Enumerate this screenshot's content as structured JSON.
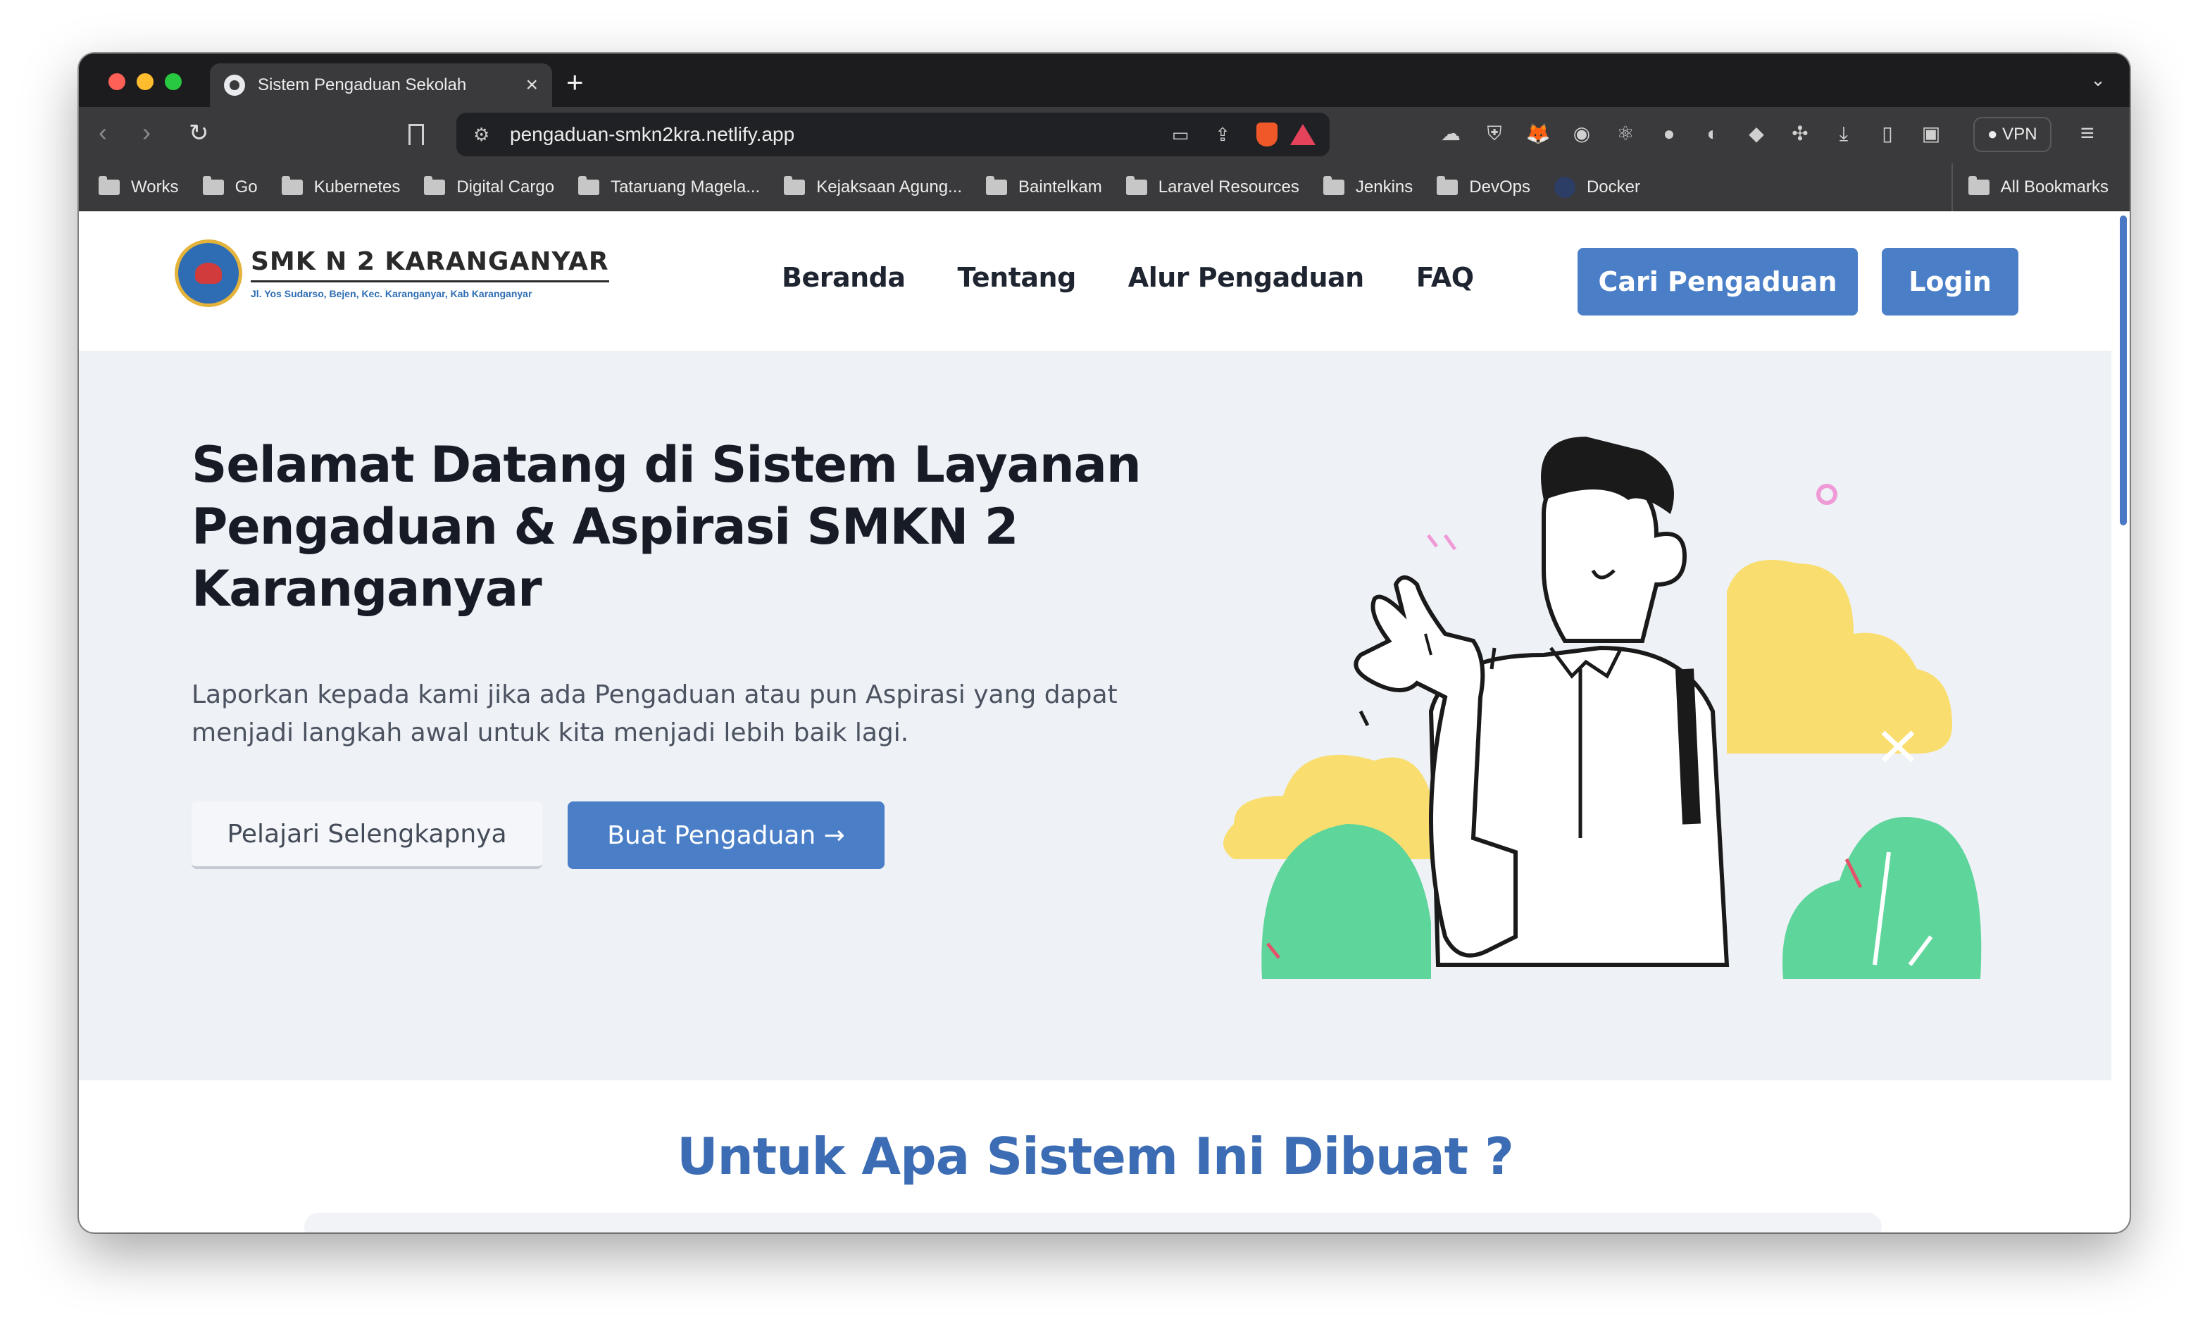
{
  "browser": {
    "tab_title": "Sistem Pengaduan Sekolah",
    "tab_close": "×",
    "new_tab": "+",
    "tab_menu": "⌄",
    "nav_back": "‹",
    "nav_forward": "›",
    "nav_reload": "↻",
    "site_info_icon": "⚙",
    "url": "pengaduan-smkn2kra.netlify.app",
    "cast_icon": "▭",
    "share_icon": "⇪",
    "vpn_label": "VPN",
    "menu_icon": "≡",
    "extension_icons": [
      "cloud-icon",
      "shield-icon",
      "fox-icon",
      "camera-icon",
      "react-icon",
      "brain-icon",
      "cat-icon",
      "puzzle-badge-icon",
      "puzzle-icon",
      "download-icon",
      "sidebar-icon",
      "wallet-icon"
    ],
    "extension_glyphs": [
      "☁",
      "⛨",
      "🦊",
      "◉",
      "⚛",
      "●",
      "◐",
      "◆",
      "✣",
      "⤓",
      "▯",
      "▣"
    ],
    "bookmarks": [
      "Works",
      "Go",
      "Kubernetes",
      "Digital Cargo",
      "Tataruang Magela...",
      "Kejaksaan Agung...",
      "Baintelkam",
      "Laravel Resources",
      "Jenkins",
      "DevOps"
    ],
    "bookmark_docker": "Docker",
    "bookmark_all": "All Bookmarks"
  },
  "site": {
    "logo_name": "SMK N 2 KARANGANYAR",
    "logo_address": "Jl. Yos Sudarso, Bejen, Kec. Karanganyar, Kab Karanganyar",
    "menu": [
      "Beranda",
      "Tentang",
      "Alur Pengaduan",
      "FAQ"
    ],
    "search_button": "Cari Pengaduan",
    "login_button": "Login",
    "hero_title": "Selamat Datang di Sistem Layanan Pengaduan & Aspirasi SMKN 2 Karanganyar",
    "hero_description": "Laporkan kepada kami jika ada Pengaduan atau pun Aspirasi yang dapat menjadi langkah awal untuk kita menjadi lebih baik lagi.",
    "learn_more_button": "Pelajari Selengkapnya",
    "create_report_button": "Buat Pengaduan →",
    "section_title": "Untuk Apa Sistem Ini Dibuat ?"
  },
  "colors": {
    "brand_blue": "#4a7fc8",
    "heading_blue": "#3c6cb3",
    "hero_bg": "#eef1f6",
    "accent_yellow": "#f9de6f",
    "accent_green": "#5ed59b"
  }
}
